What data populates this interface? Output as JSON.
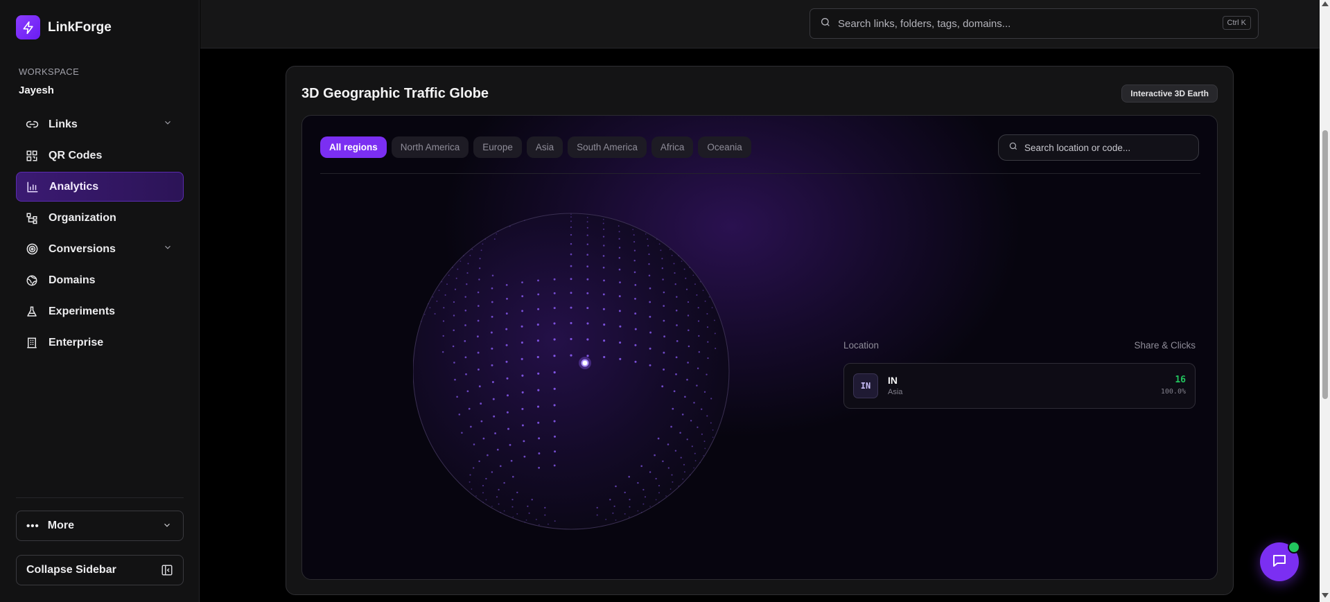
{
  "app": {
    "name": "LinkForge",
    "accent": "#7b2ff2"
  },
  "workspace": {
    "label": "WORKSPACE",
    "name": "Jayesh"
  },
  "sidebar": {
    "items": [
      {
        "label": "Links",
        "icon": "link-icon",
        "expandable": true
      },
      {
        "label": "QR Codes",
        "icon": "qr-code-icon",
        "expandable": false
      },
      {
        "label": "Analytics",
        "icon": "bar-chart-icon",
        "expandable": false,
        "active": true
      },
      {
        "label": "Organization",
        "icon": "org-tree-icon",
        "expandable": false
      },
      {
        "label": "Conversions",
        "icon": "target-icon",
        "expandable": true
      },
      {
        "label": "Domains",
        "icon": "globe-icon",
        "expandable": false
      },
      {
        "label": "Experiments",
        "icon": "flask-icon",
        "expandable": false
      },
      {
        "label": "Enterprise",
        "icon": "building-icon",
        "expandable": false
      }
    ],
    "more_label": "More",
    "collapse_label": "Collapse Sidebar"
  },
  "header": {
    "search_placeholder": "Search links, folders, tags, domains...",
    "shortcut": "Ctrl K"
  },
  "globe_card": {
    "title": "3D Geographic Traffic Globe",
    "badge": "Interactive 3D Earth",
    "region_filters": [
      "All regions",
      "North America",
      "Europe",
      "Asia",
      "South America",
      "Africa",
      "Oceania"
    ],
    "active_filter": "All regions",
    "location_search_placeholder": "Search location or code...",
    "table": {
      "col_location": "Location",
      "col_share": "Share & Clicks",
      "rows": [
        {
          "code": "IN",
          "name": "IN",
          "region": "Asia",
          "clicks": "16",
          "share": "100.0%"
        }
      ]
    }
  }
}
